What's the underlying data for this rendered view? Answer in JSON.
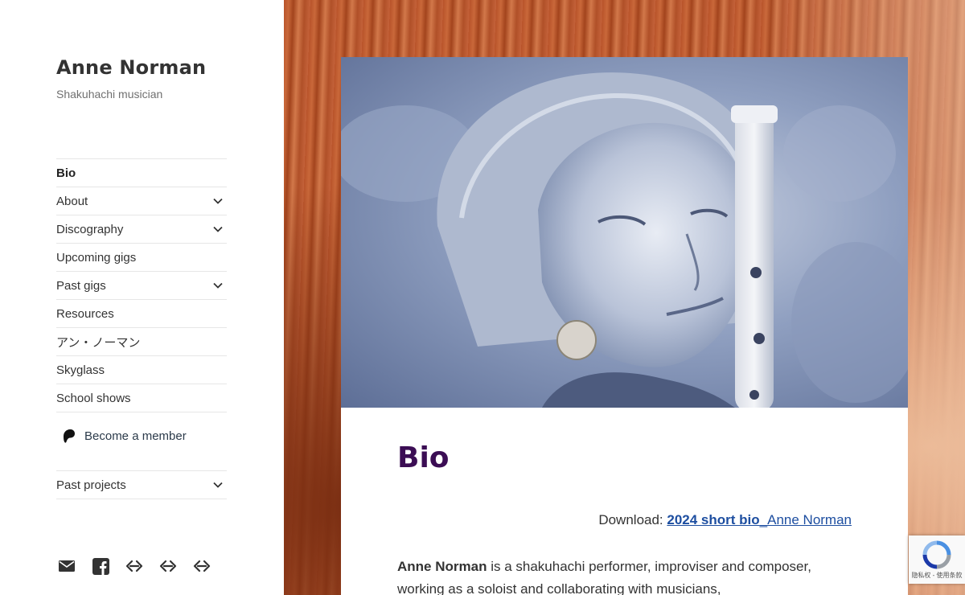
{
  "site": {
    "title": "Anne Norman",
    "description": "Shakuhachi musician"
  },
  "nav": {
    "items": [
      {
        "label": "Bio",
        "current": true,
        "submenu": false
      },
      {
        "label": "About",
        "current": false,
        "submenu": true
      },
      {
        "label": "Discography",
        "current": false,
        "submenu": true
      },
      {
        "label": "Upcoming gigs",
        "current": false,
        "submenu": false
      },
      {
        "label": "Past gigs",
        "current": false,
        "submenu": true
      },
      {
        "label": "Resources",
        "current": false,
        "submenu": false
      },
      {
        "label": "アン・ノーマン",
        "current": false,
        "submenu": false
      },
      {
        "label": "Skyglass",
        "current": false,
        "submenu": false
      },
      {
        "label": "School shows",
        "current": false,
        "submenu": false
      }
    ],
    "member_label": "Become a member",
    "member_icon": "patreon-icon",
    "past_projects_label": "Past projects"
  },
  "social": {
    "icons": [
      "email-icon",
      "facebook-icon",
      "link-icon",
      "link-icon",
      "link-icon"
    ]
  },
  "article": {
    "title": "Bio",
    "download_prefix": "Download: ",
    "download_link_bold": "2024 short bio",
    "download_link_rest": "_Anne Norman",
    "paragraph_bold": "Anne Norman",
    "paragraph_rest": " is a shakuhachi performer, improviser and composer, working as a soloist and collaborating with musicians,"
  },
  "recaptcha": {
    "text": "隐私权 - 使用条款"
  },
  "colors": {
    "title": "#3b0d54",
    "link": "#1d4ea0",
    "text": "#333333"
  }
}
